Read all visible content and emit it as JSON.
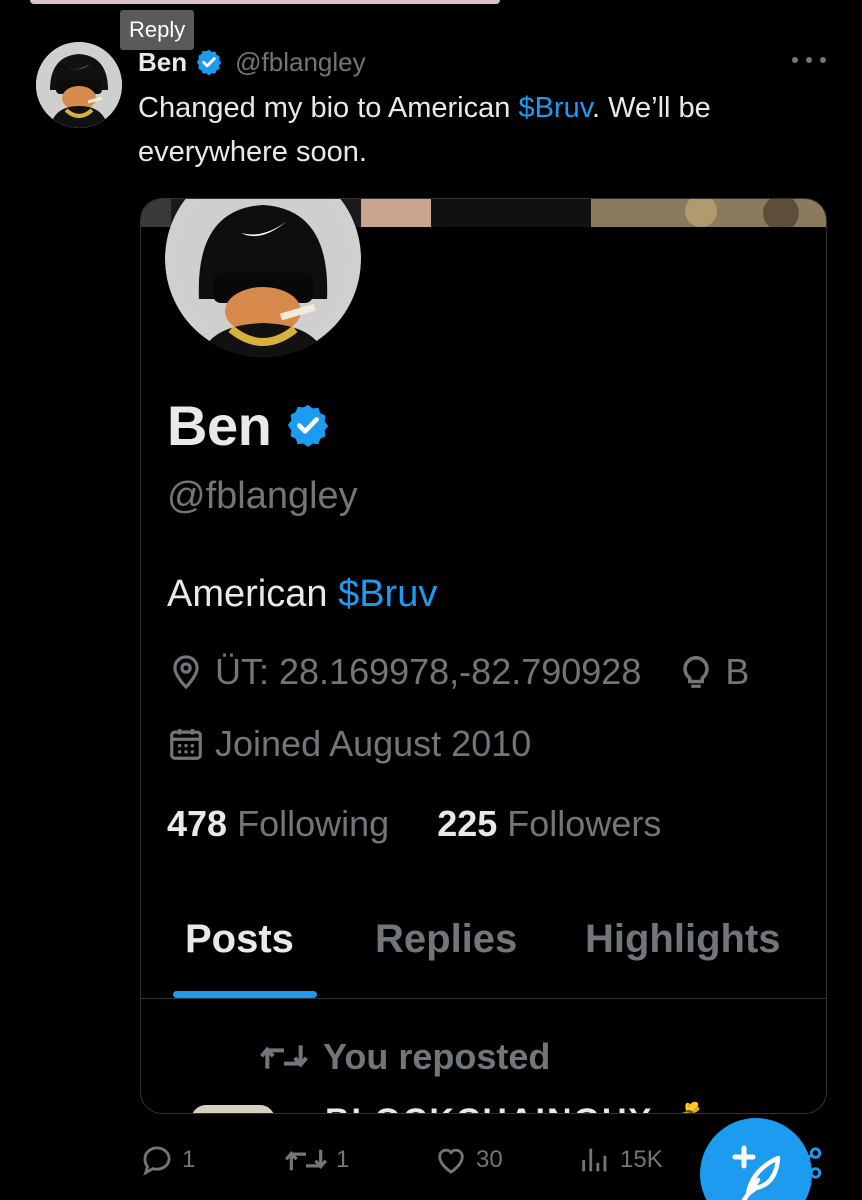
{
  "tooltip": {
    "label": "Reply"
  },
  "tweet": {
    "author_name": "Ben",
    "author_handle": "@fblangley",
    "text_before": "Changed my bio to American ",
    "text_cashtag": "$Bruv",
    "text_after": ". We’ll be everywhere soon."
  },
  "profile": {
    "name": "Ben",
    "handle": "@fblangley",
    "bio_prefix": "American ",
    "bio_cashtag": "$Bruv",
    "location": "ÜT: 28.169978,-82.790928",
    "extra_meta": "B",
    "joined": "Joined August 2010",
    "following_count": "478",
    "following_label": "Following",
    "followers_count": "225",
    "followers_label": "Followers",
    "tabs": [
      {
        "label": "Posts",
        "active": true
      },
      {
        "label": "Replies",
        "active": false
      },
      {
        "label": "Highlights",
        "active": false
      }
    ],
    "repost_label": "You reposted",
    "next_post_author": "BLOCKCHAINGUY 💰"
  },
  "actions": {
    "replies": "1",
    "reposts": "1",
    "likes": "30",
    "views": "15K"
  },
  "colors": {
    "background": "#000000",
    "accent": "#1d9bf0",
    "text_primary": "#e7e9ea",
    "text_secondary": "#71767b",
    "border": "#2f3336"
  },
  "icons": [
    "verified-badge-icon",
    "more-icon",
    "location-icon",
    "bulb-icon",
    "calendar-icon",
    "repost-icon",
    "reply-icon",
    "like-icon",
    "views-icon",
    "compose-icon",
    "share-icon"
  ]
}
